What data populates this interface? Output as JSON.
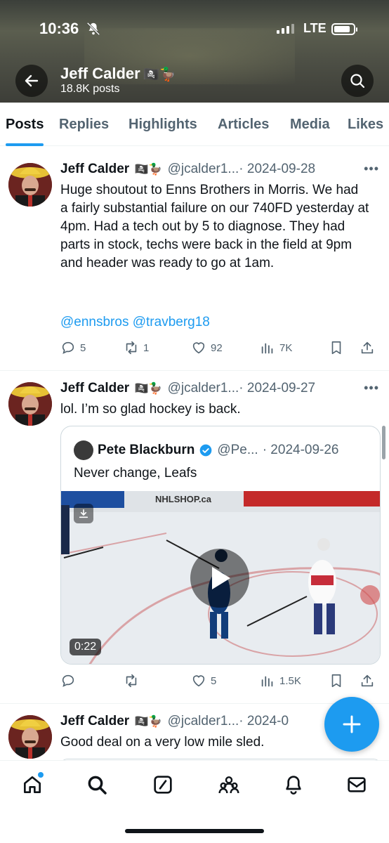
{
  "status_bar": {
    "time": "10:36",
    "network": "LTE"
  },
  "header": {
    "name": "Jeff Calder",
    "name_emoji": "🏴‍☠️🦆",
    "post_count": "18.8K posts"
  },
  "tabs": [
    {
      "label": "Posts",
      "active": true
    },
    {
      "label": "Replies",
      "active": false
    },
    {
      "label": "Highlights",
      "active": false
    },
    {
      "label": "Articles",
      "active": false
    },
    {
      "label": "Media",
      "active": false
    },
    {
      "label": "Likes",
      "active": false
    }
  ],
  "tweets": [
    {
      "name": "Jeff Calder",
      "emoji": "🏴‍☠️🦆",
      "handle": "@jcalder1...",
      "date": "· 2024-09-28",
      "text": "Huge shoutout to Enns Brothers in Morris. We had a fairly substantial failure on our 740FD yesterday at 4pm. Had a tech out by 5 to diagnose. They had parts in stock, techs were back in the field at 9pm and header was ready to go at 1am.",
      "mentions": "@ennsbros @travberg18",
      "replies": "5",
      "reposts": "1",
      "likes": "92",
      "views": "7K"
    },
    {
      "name": "Jeff Calder",
      "emoji": "🏴‍☠️🦆",
      "handle": "@jcalder1...",
      "date": "· 2024-09-27",
      "text": "lol. I’m so glad hockey is back.",
      "quote": {
        "name": "Pete Blackburn",
        "handle": "@Pe...",
        "date": "· 2024-09-26",
        "text": "Never change, Leafs",
        "video_duration": "0:22",
        "video_board_text": "NHLSHOP.ca"
      },
      "replies": "",
      "reposts": "",
      "likes": "5",
      "views": "1.5K"
    },
    {
      "name": "Jeff Calder",
      "emoji": "🏴‍☠️🦆",
      "handle": "@jcalder1...",
      "date": "· 2024-0",
      "text": "Good deal on a very low mile sled."
    }
  ],
  "colors": {
    "accent": "#1d9bf0",
    "text": "#0f1419",
    "secondary": "#536471"
  }
}
